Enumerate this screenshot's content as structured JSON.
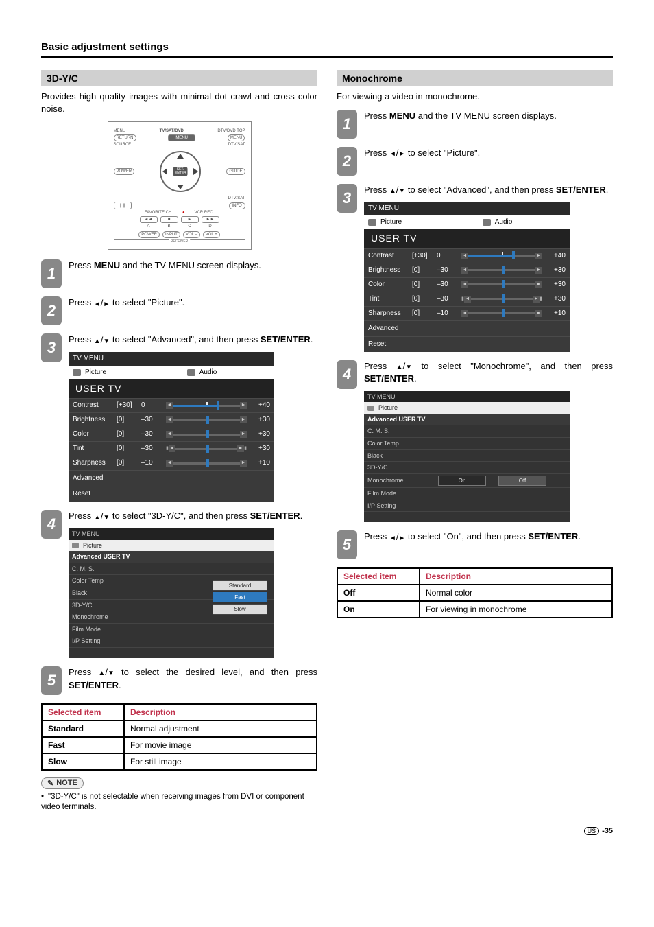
{
  "page_title": "Basic adjustment settings",
  "left": {
    "header": "3D-Y/C",
    "intro": "Provides high quality images with minimal dot crawl and cross color noise.",
    "remote": {
      "row1": {
        "l": "MENU",
        "c": "TV/SAT/DVD",
        "r": "DTV/DVD TOP"
      },
      "row2": {
        "l": "RETURN",
        "c": "MENU",
        "r": "MENU"
      },
      "row3": {
        "l": "SOURCE",
        "r": "DTV/SAT"
      },
      "row4": {
        "l": "POWER",
        "r": "GUIDE"
      },
      "dpad_center": "SET/\nENTER",
      "row5_r": "DTV/SAT",
      "row6": {
        "l": "❙❙",
        "r": "INFO"
      },
      "fav": "FAVORITE CH.",
      "vcr": "VCR REC.",
      "transport": {
        "a": "◄◄",
        "b": "■",
        "c": "►",
        "d": "►►"
      },
      "tlabels": {
        "a": "A",
        "b": "B",
        "c": "C",
        "d": "D"
      },
      "bottom": {
        "p": "POWER",
        "i": "INPUT",
        "vm": "VOL –",
        "vp": "VOL +"
      },
      "receiver": "RECEIVER"
    },
    "steps": {
      "s1": "Press MENU and the TV MENU screen displays.",
      "s1_bold": "MENU",
      "s2_pre": "Press ",
      "s2_post": " to select \"Picture\".",
      "s3_pre": "Press ",
      "s3_mid": " to select \"Advanced\", and then press ",
      "s3_bold": "SET/ENTER",
      "s4_pre": "Press ",
      "s4_mid": " to select \"3D-Y/C\", and then press ",
      "s4_bold": "SET/ENTER",
      "s5_pre": "Press ",
      "s5_mid": " to select the desired level, and then press ",
      "s5_bold": "SET/ENTER"
    },
    "tvmenu": {
      "hdr": "TV MENU",
      "tab_pic": "Picture",
      "tab_aud": "Audio",
      "usertv": "USER TV",
      "rows": [
        {
          "lab": "Contrast",
          "v1": "[+30]",
          "v2": "0",
          "v3": "+40",
          "fillL": 0,
          "fillR": 65,
          "th": 65
        },
        {
          "lab": "Brightness",
          "v1": "[0]",
          "v2": "–30",
          "v3": "+30",
          "fillL": 50,
          "fillR": 50,
          "th": 50
        },
        {
          "lab": "Color",
          "v1": "[0]",
          "v2": "–30",
          "v3": "+30",
          "fillL": 50,
          "fillR": 50,
          "th": 50
        },
        {
          "lab": "Tint",
          "v1": "[0]",
          "v2": "–30",
          "v3": "+30",
          "fillL": 50,
          "fillR": 50,
          "th": 50,
          "bars": true
        },
        {
          "lab": "Sharpness",
          "v1": "[0]",
          "v2": "–10",
          "v3": "+10",
          "fillL": 50,
          "fillR": 50,
          "th": 50
        }
      ],
      "adv": "Advanced",
      "reset": "Reset"
    },
    "advmenu": {
      "hdr": "TV MENU",
      "tab": "Picture",
      "sub": "Advanced USER TV",
      "items": [
        "C. M. S.",
        "Color Temp",
        "Black",
        "3D-Y/C",
        "Monochrome",
        "Film Mode",
        "I/P Setting"
      ],
      "options": [
        "Standard",
        "Fast",
        "Slow"
      ]
    },
    "table": {
      "h1": "Selected item",
      "h2": "Description",
      "rows": [
        {
          "k": "Standard",
          "v": "Normal adjustment"
        },
        {
          "k": "Fast",
          "v": "For movie image"
        },
        {
          "k": "Slow",
          "v": "For still image"
        }
      ]
    },
    "note_label": "NOTE",
    "note_text": "\"3D-Y/C\" is not selectable when receiving images from DVI or component video terminals."
  },
  "right": {
    "header": "Monochrome",
    "intro": "For viewing a video in monochrome.",
    "steps": {
      "s1": "Press MENU and the TV MENU screen displays.",
      "s1_bold": "MENU",
      "s2_pre": "Press ",
      "s2_post": " to select \"Picture\".",
      "s3_pre": "Press ",
      "s3_mid": " to select \"Advanced\", and then press ",
      "s3_bold": "SET/ENTER",
      "s4_pre": "Press ",
      "s4_mid": " to select \"Monochrome\", and then press ",
      "s4_bold": "SET/ENTER",
      "s5_pre": "Press ",
      "s5_mid": " to select \"On\", and then press ",
      "s5_bold": "SET/ENTER"
    },
    "advmenu": {
      "hdr": "TV MENU",
      "tab": "Picture",
      "sub": "Advanced USER TV",
      "items": [
        "C. M. S.",
        "Color Temp",
        "Black",
        "3D-Y/C",
        "Monochrome",
        "Film Mode",
        "I/P Setting"
      ],
      "on": "On",
      "off": "Off"
    },
    "table": {
      "h1": "Selected item",
      "h2": "Description",
      "rows": [
        {
          "k": "Off",
          "v": "Normal color"
        },
        {
          "k": "On",
          "v": "For viewing in monochrome"
        }
      ]
    }
  },
  "footer": {
    "region": "US",
    "page": "-35"
  }
}
